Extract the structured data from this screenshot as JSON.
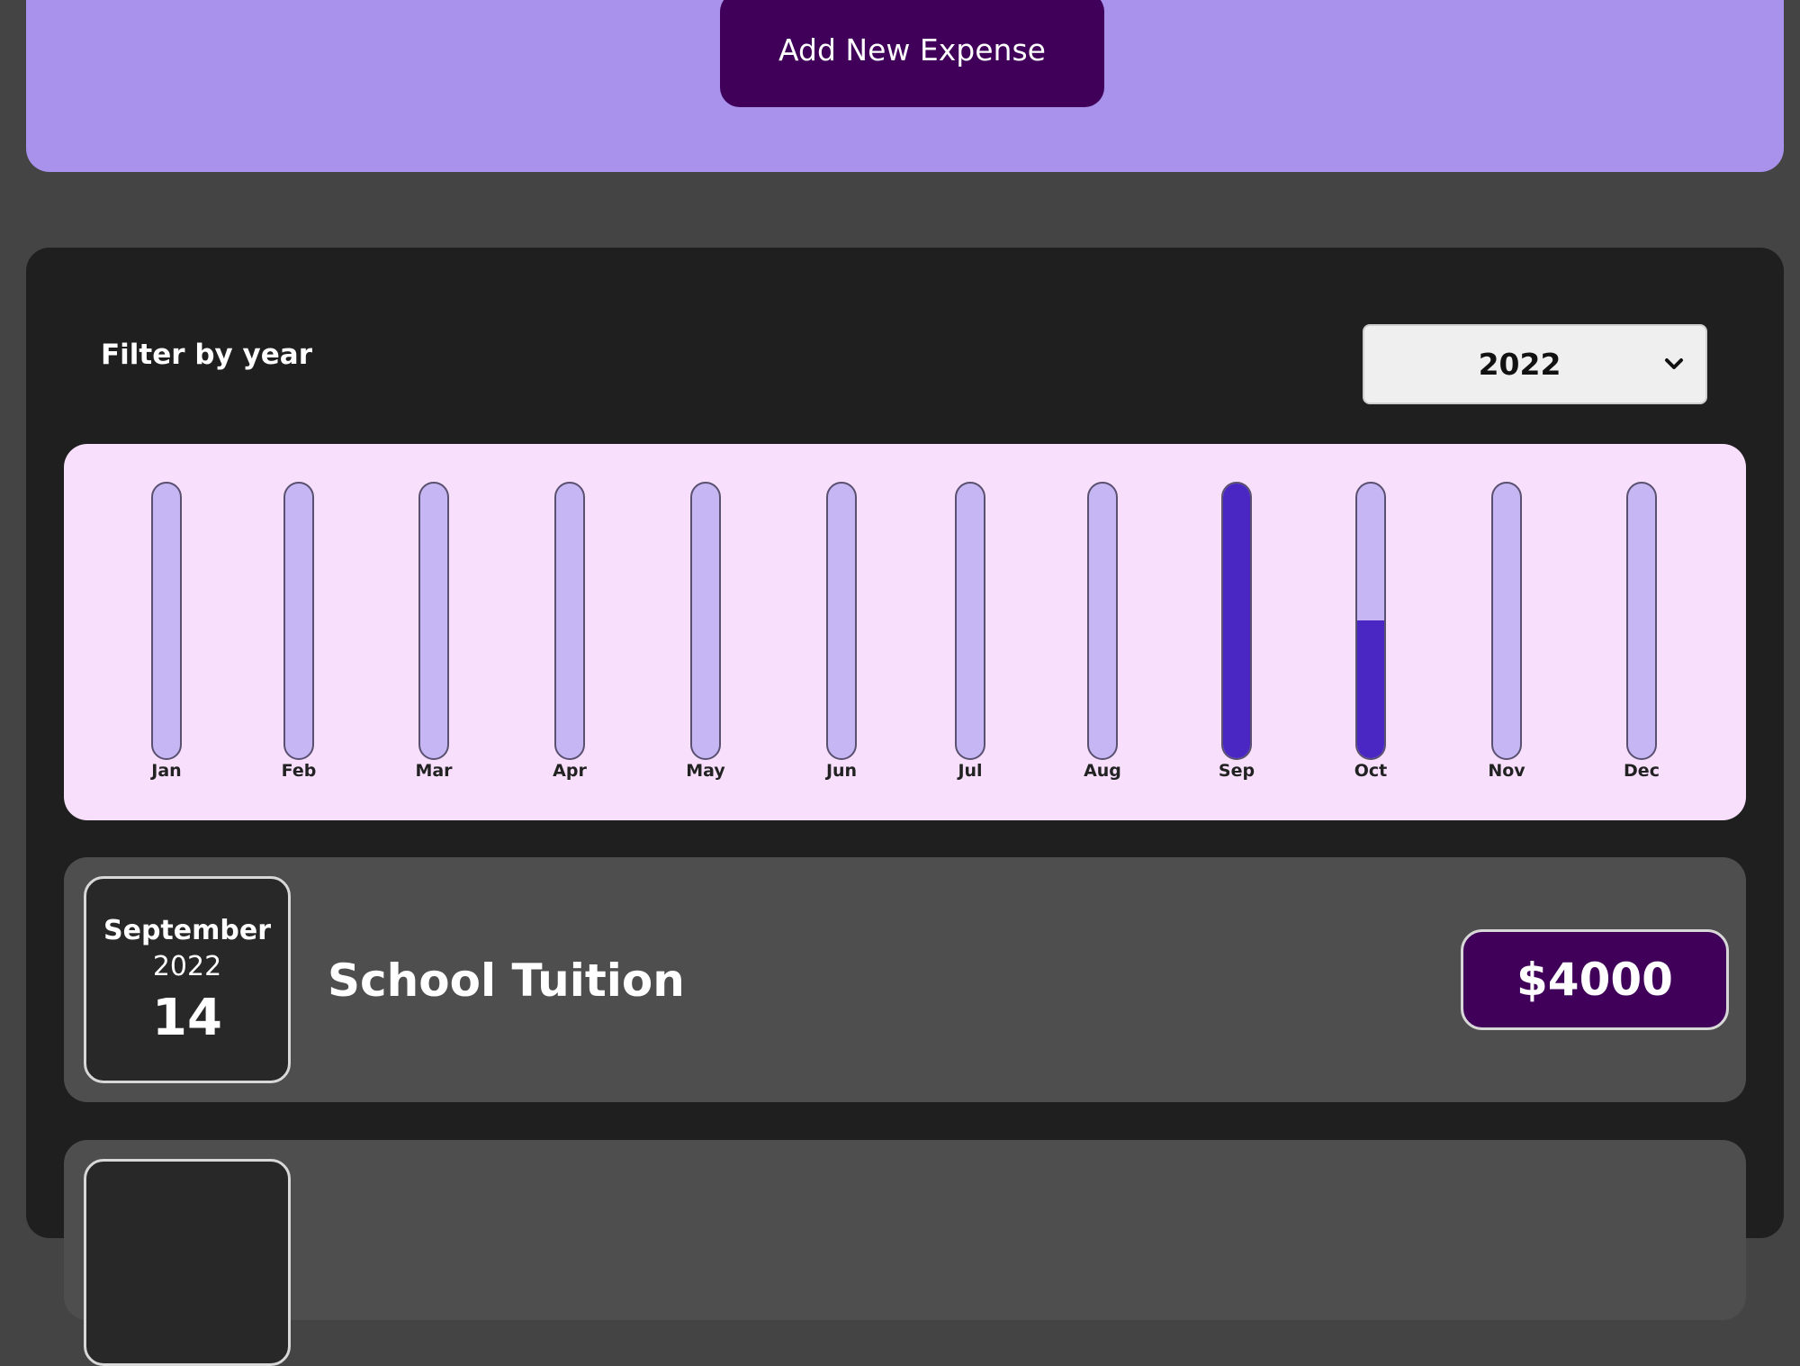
{
  "header": {
    "add_button_label": "Add New Expense"
  },
  "filter": {
    "label": "Filter by year",
    "selected_year": "2022"
  },
  "chart_data": {
    "type": "bar",
    "categories": [
      "Jan",
      "Feb",
      "Mar",
      "Apr",
      "May",
      "Jun",
      "Jul",
      "Aug",
      "Sep",
      "Oct",
      "Nov",
      "Dec"
    ],
    "values": [
      0,
      0,
      0,
      0,
      0,
      0,
      0,
      0,
      1.0,
      0.5,
      0,
      0
    ],
    "ylim": [
      0,
      1
    ],
    "grid": false,
    "colors": {
      "track": "#c6b7f4",
      "fill": "#4a26c2",
      "background": "#f8e0fd"
    }
  },
  "expenses": [
    {
      "month": "September",
      "year": "2022",
      "day": "14",
      "title": "School Tuition",
      "amount": "$4000"
    }
  ],
  "colors": {
    "accent": "#40005a",
    "header_bg": "#a892ec",
    "panel_bg": "#1f1f1f",
    "item_bg": "#4e4e4e",
    "page_bg": "#444444"
  }
}
